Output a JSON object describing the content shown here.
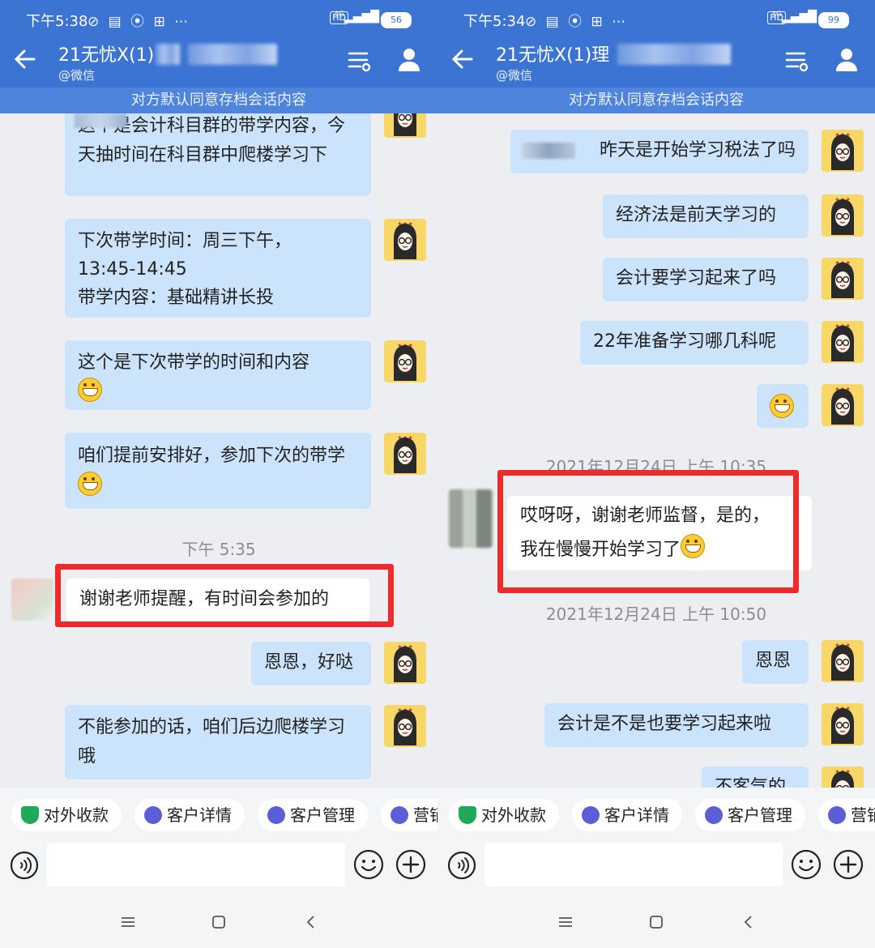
{
  "colors": {
    "header": "#3c74d4",
    "notice": "#4e84dc",
    "bubble": "#cce4fb",
    "highlight": "#ef2a2a"
  },
  "left": {
    "status": {
      "time": "下午5:38",
      "icons": "⊘ ▤ ⦿ ⊞ ⋯",
      "hd": "HD",
      "net": "4G",
      "battery": "56"
    },
    "title": "21无忧X(1)",
    "subtitle": "@微信",
    "notice": "对方默认同意存档会话内容",
    "messages": [
      {
        "side": "right",
        "text": "这个是会计科目群的带学内容，今天抽时间在科目群中爬楼学习下"
      },
      {
        "side": "right",
        "lines": [
          "下次带学时间：周三下午，",
          "13:45-14:45",
          "带学内容：基础精讲长投"
        ]
      },
      {
        "side": "right",
        "text": "这个是下次带学的时间和内容"
      },
      {
        "side": "right",
        "text": "咱们提前安排好，参加下次的带学"
      },
      {
        "side": "left",
        "text": "谢谢老师提醒，有时间会参加的"
      },
      {
        "side": "right",
        "text": "恩恩，好哒"
      },
      {
        "side": "right",
        "text": "不能参加的话，咱们后边爬楼学习哦"
      }
    ],
    "timestamp": "下午 5:35",
    "chips": [
      "对外收款",
      "客户详情",
      "客户管理",
      "营销"
    ]
  },
  "right": {
    "status": {
      "time": "下午5:34",
      "icons": "⊘ ▤ ⦿ ⊞ ⋯",
      "hd": "HD",
      "net": "4G",
      "battery": "99"
    },
    "title": "21无忧X(1)理",
    "subtitle": "@微信",
    "notice": "对方默认同意存档会话内容",
    "messages": [
      {
        "side": "right",
        "text": "昨天是开始学习税法了吗"
      },
      {
        "side": "right",
        "text": "经济法是前天学习的"
      },
      {
        "side": "right",
        "text": "会计要学习起来了吗"
      },
      {
        "side": "right",
        "text": "22年准备学习哪几科呢"
      },
      {
        "side": "left",
        "lines": [
          "哎呀呀，谢谢老师监督，是的，",
          "我在慢慢开始学习了"
        ]
      },
      {
        "side": "right",
        "text": "恩恩"
      },
      {
        "side": "right",
        "text": "会计是不是也要学习起来啦"
      },
      {
        "side": "right",
        "text": "不客气的"
      }
    ],
    "timestamps": [
      "2021年12月24日 上午 10:35",
      "2021年12月24日 上午 10:50"
    ],
    "chips": [
      "对外收款",
      "客户详情",
      "客户管理",
      "营销"
    ]
  }
}
